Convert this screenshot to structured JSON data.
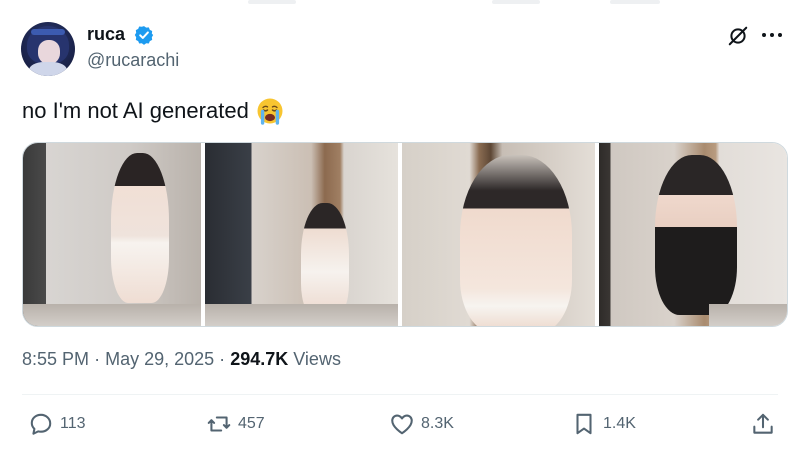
{
  "author": {
    "display_name": "ruca",
    "handle": "@rucarachi",
    "verified": true,
    "verified_color": "#1d9bf0"
  },
  "tweet": {
    "text": "no I'm not AI generated",
    "emoji": "loudly-crying-face"
  },
  "media": {
    "photo_count": 4
  },
  "meta": {
    "time": "8:55 PM",
    "separator": "·",
    "date": "May 29, 2025",
    "views_count": "294.7K",
    "views_label": "Views"
  },
  "actions": {
    "replies": "113",
    "reposts": "457",
    "likes": "8.3K",
    "bookmarks": "1.4K"
  },
  "colors": {
    "text": "#0f1419",
    "secondary": "#536471",
    "accent": "#1d9bf0"
  }
}
